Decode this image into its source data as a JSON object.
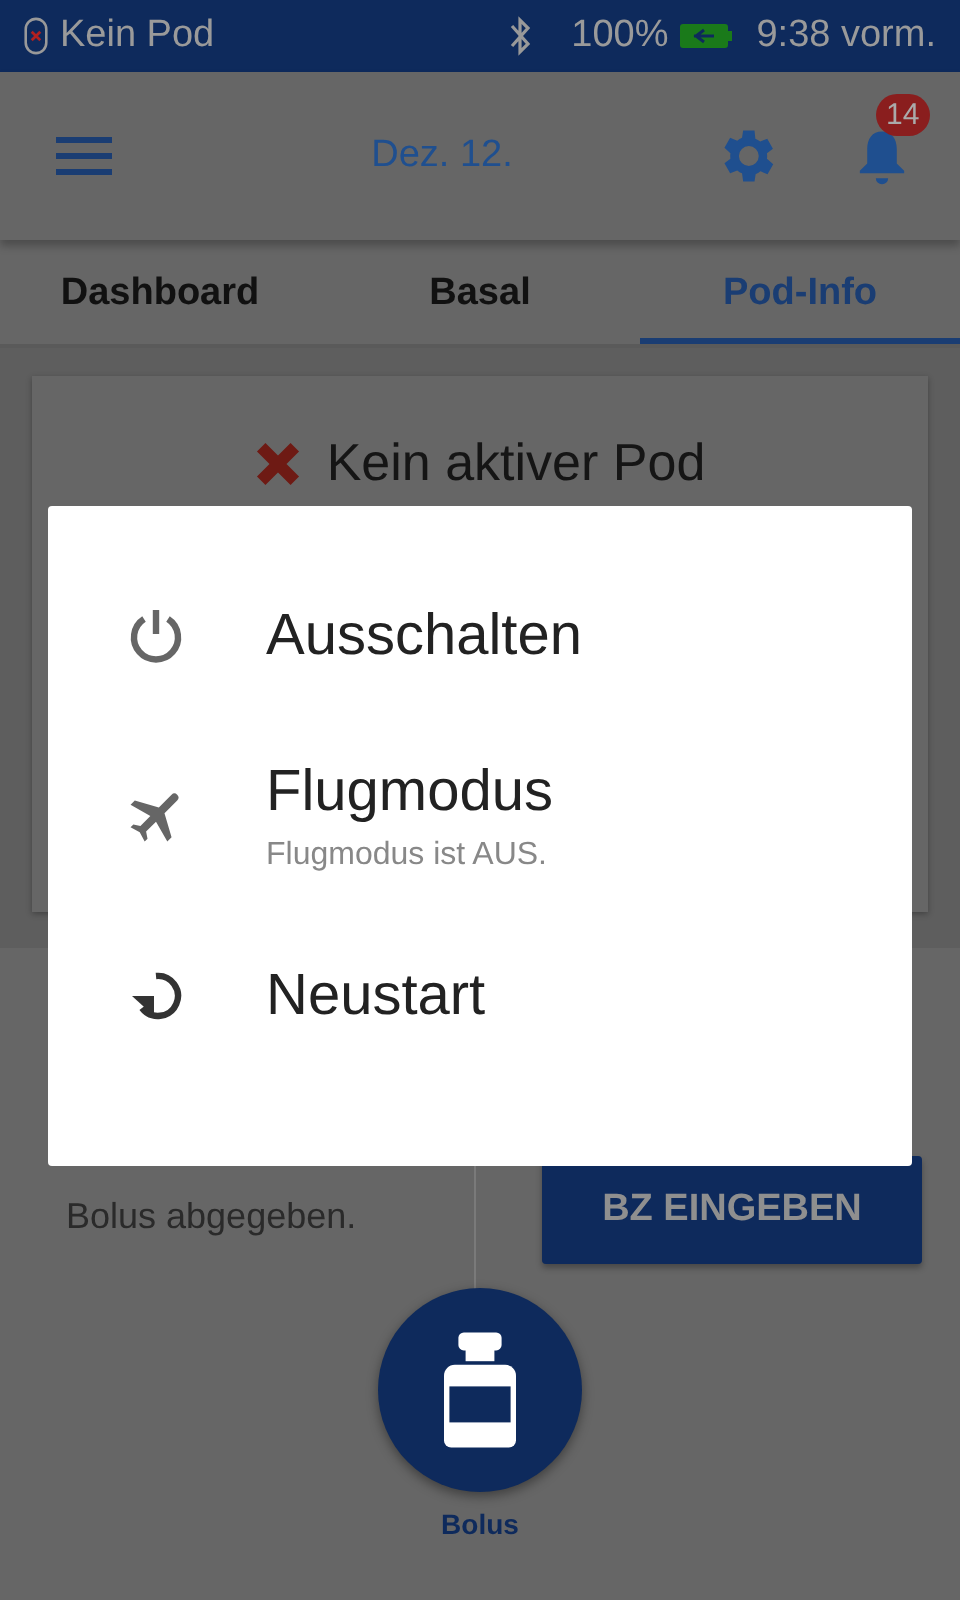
{
  "status_bar": {
    "pod_status": "Kein Pod",
    "battery": "100%",
    "time": "9:38 vorm."
  },
  "header": {
    "date": "Dez. 12.",
    "notification_count": "14"
  },
  "tabs": [
    {
      "label": "Dashboard",
      "selected": false
    },
    {
      "label": "Basal",
      "selected": false
    },
    {
      "label": "Pod-Info",
      "selected": true
    }
  ],
  "pod_card": {
    "message": "Kein aktiver Pod"
  },
  "bolus_panel": {
    "message": "Bolus abgegeben.",
    "button": "BZ EINGEBEN",
    "fab_label": "Bolus"
  },
  "dialog": {
    "options": [
      {
        "kind": "power",
        "label": "Ausschalten"
      },
      {
        "kind": "airplane",
        "label": "Flugmodus",
        "sublabel": "Flugmodus ist AUS."
      },
      {
        "kind": "restart",
        "label": "Neustart"
      }
    ]
  }
}
